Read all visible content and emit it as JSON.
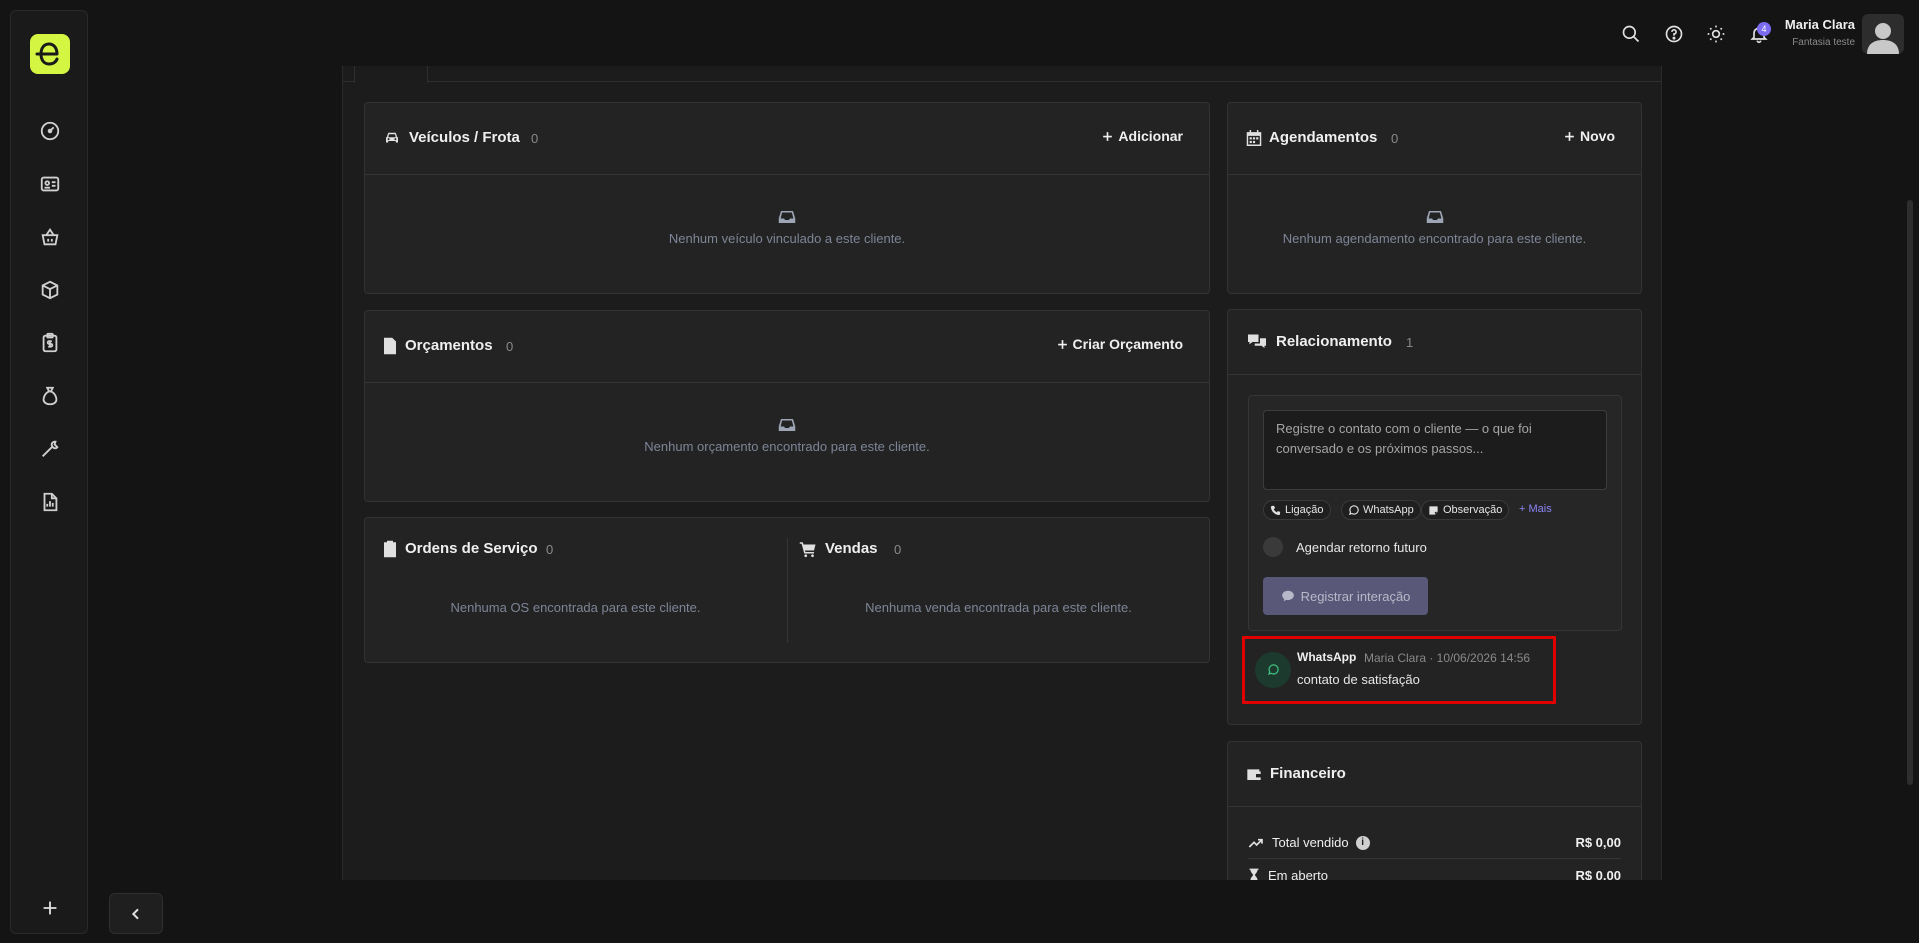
{
  "header": {
    "user_name": "Maria Clara",
    "user_company": "Fantasia teste",
    "notifications_count": "4"
  },
  "sidebar": {
    "items": [
      {
        "icon": "dashboard-icon"
      },
      {
        "icon": "id-card-icon"
      },
      {
        "icon": "basket-icon"
      },
      {
        "icon": "box-icon"
      },
      {
        "icon": "clipboard-money-icon"
      },
      {
        "icon": "money-bag-icon"
      },
      {
        "icon": "wrench-icon"
      },
      {
        "icon": "report-icon"
      }
    ]
  },
  "vehicles": {
    "title": "Veículos / Frota",
    "count": "0",
    "action": "Adicionar",
    "empty": "Nenhum veículo vinculado a este cliente."
  },
  "quotes": {
    "title": "Orçamentos",
    "count": "0",
    "action": "Criar Orçamento",
    "empty": "Nenhum orçamento encontrado para este cliente."
  },
  "service_orders": {
    "title": "Ordens de Serviço",
    "count": "0",
    "empty": "Nenhuma OS encontrada para este cliente."
  },
  "sales": {
    "title": "Vendas",
    "count": "0",
    "empty": "Nenhuma venda encontrada para este cliente."
  },
  "appointments": {
    "title": "Agendamentos",
    "count": "0",
    "action": "Novo",
    "empty": "Nenhum agendamento encontrado para este cliente."
  },
  "relationship": {
    "title": "Relacionamento",
    "count": "1",
    "placeholder": "Registre o contato com o cliente — o que foi conversado e os próximos passos...",
    "chips": [
      "Ligação",
      "WhatsApp",
      "Observação"
    ],
    "more": "+ Mais",
    "schedule_label": "Agendar retorno futuro",
    "register_label": "Registrar interação",
    "interaction": {
      "type": "WhatsApp",
      "meta": "Maria Clara · 10/06/2026 14:56",
      "text": "contato de satisfação"
    }
  },
  "finance": {
    "title": "Financeiro",
    "rows": [
      {
        "label": "Total vendido",
        "value": "R$ 0,00"
      },
      {
        "label": "Em aberto",
        "value": "R$ 0,00"
      }
    ]
  },
  "colors": {
    "brand": "#d4f542",
    "accent": "#7c6cf0",
    "highlight": "#e00000"
  }
}
